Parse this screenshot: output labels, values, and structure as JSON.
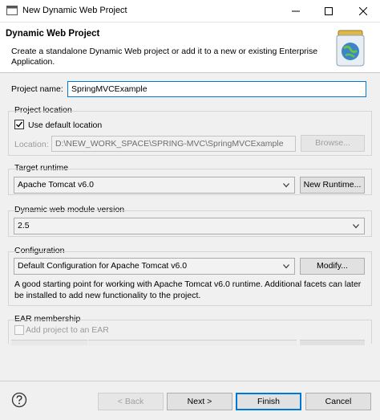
{
  "window": {
    "title": "New Dynamic Web Project"
  },
  "header": {
    "title": "Dynamic Web Project",
    "description": "Create a standalone Dynamic Web project or add it to a new or existing Enterprise Application."
  },
  "project_name": {
    "label": "Project name:",
    "value": "SpringMVCExample"
  },
  "project_location": {
    "group_label": "Project location",
    "use_default_label": "Use default location",
    "use_default_checked": true,
    "location_label": "Location:",
    "location_value": "D:\\NEW_WORK_SPACE\\SPRING-MVC\\SpringMVCExample",
    "browse_label": "Browse..."
  },
  "target_runtime": {
    "group_label": "Target runtime",
    "selected": "Apache Tomcat v6.0",
    "new_runtime_label": "New Runtime..."
  },
  "module_version": {
    "group_label": "Dynamic web module version",
    "selected": "2.5"
  },
  "configuration": {
    "group_label": "Configuration",
    "selected": "Default Configuration for Apache Tomcat v6.0",
    "modify_label": "Modify...",
    "description": "A good starting point for working with Apache Tomcat v6.0 runtime. Additional facets can later be installed to add new functionality to the project."
  },
  "ear": {
    "group_label": "EAR membership",
    "add_label": "Add project to an EAR",
    "add_checked": false
  },
  "footer": {
    "back_label": "< Back",
    "next_label": "Next >",
    "finish_label": "Finish",
    "cancel_label": "Cancel"
  },
  "icons": {
    "help": "help-icon",
    "app": "window-app-icon",
    "banner": "web-project-jar-icon"
  }
}
